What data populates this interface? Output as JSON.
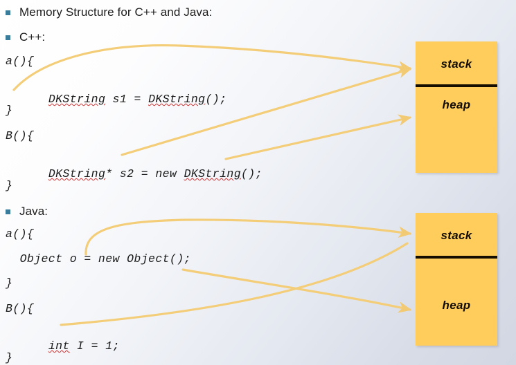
{
  "slide": {
    "background_top_color": "#ffffff",
    "background_bottom_color": "#d2d7e3",
    "bullet_color": "#3a7c9a",
    "arrow_color": "#f5cf7a",
    "memory_box_color": "#ffcd5c",
    "memory_divider_color": "#140d00"
  },
  "bullets": [
    {
      "label": "Memory Structure for C++ and Java:"
    },
    {
      "label": "C++:"
    },
    {
      "label": "Java:"
    }
  ],
  "cpp_code": [
    {
      "text": "a(){"
    },
    {
      "text": "  DKString s1 = DKString();",
      "misspelled": "DKString"
    },
    {
      "text": "}"
    },
    {
      "text": "B(){"
    },
    {
      "text": "  DKString* s2 = new DKString();",
      "misspelled": "DKString"
    },
    {
      "text": "}"
    }
  ],
  "java_code": [
    {
      "text": "a(){"
    },
    {
      "text": "  Object o = new Object();"
    },
    {
      "text": "}"
    },
    {
      "text": "B(){"
    },
    {
      "text": "  int I = 1;",
      "misspelled": "int"
    },
    {
      "text": "}"
    }
  ],
  "memory_boxes": [
    {
      "name": "cpp-memory",
      "top_label": "stack",
      "bottom_label": "heap"
    },
    {
      "name": "java-memory",
      "top_label": "stack",
      "bottom_label": "heap"
    }
  ],
  "arrows": [
    {
      "name": "cpp-s1-to-stack",
      "from": "DKString s1 line",
      "to": "stack"
    },
    {
      "name": "cpp-s2-pointer-to-stack",
      "from": "s2 pointer",
      "to": "stack"
    },
    {
      "name": "cpp-s2-object-to-heap",
      "from": "new DKString()",
      "to": "heap"
    },
    {
      "name": "java-o-to-stack",
      "from": "Object o line",
      "to": "stack"
    },
    {
      "name": "java-object-to-heap",
      "from": "new Object()",
      "to": "heap"
    },
    {
      "name": "java-int-to-stack",
      "from": "int I = 1",
      "to": "stack"
    }
  ]
}
